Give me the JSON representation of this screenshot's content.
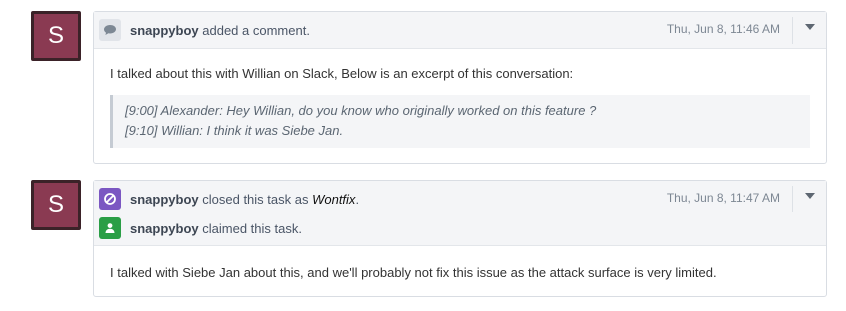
{
  "avatar_letter": "S",
  "events": [
    {
      "user": "snappyboy",
      "action": "added a comment.",
      "timestamp": "Thu, Jun 8, 11:46 AM",
      "icon": "comment-icon",
      "body": "I talked about this with Willian on Slack, Below is an excerpt of this conversation:",
      "quote_lines": [
        "[9:00] Alexander: Hey Willian, do you know who originally worked on this feature ?",
        "[9:10] Willian: I think it was Siebe Jan."
      ]
    },
    {
      "timestamp": "Thu, Jun 8, 11:47 AM",
      "lines": [
        {
          "user": "snappyboy",
          "action": "closed this task as",
          "status": "Wontfix",
          "suffix": ".",
          "icon": "closed-icon"
        },
        {
          "user": "snappyboy",
          "action": "claimed this task.",
          "icon": "user-icon"
        }
      ],
      "body": "I talked with Siebe Jan about this, and we'll probably not fix this issue as the attack surface is very limited."
    }
  ],
  "colors": {
    "avatar_bg": "#8a3a52",
    "closed_icon_bg": "#7b57c2",
    "claimed_icon_bg": "#2a9e46"
  }
}
